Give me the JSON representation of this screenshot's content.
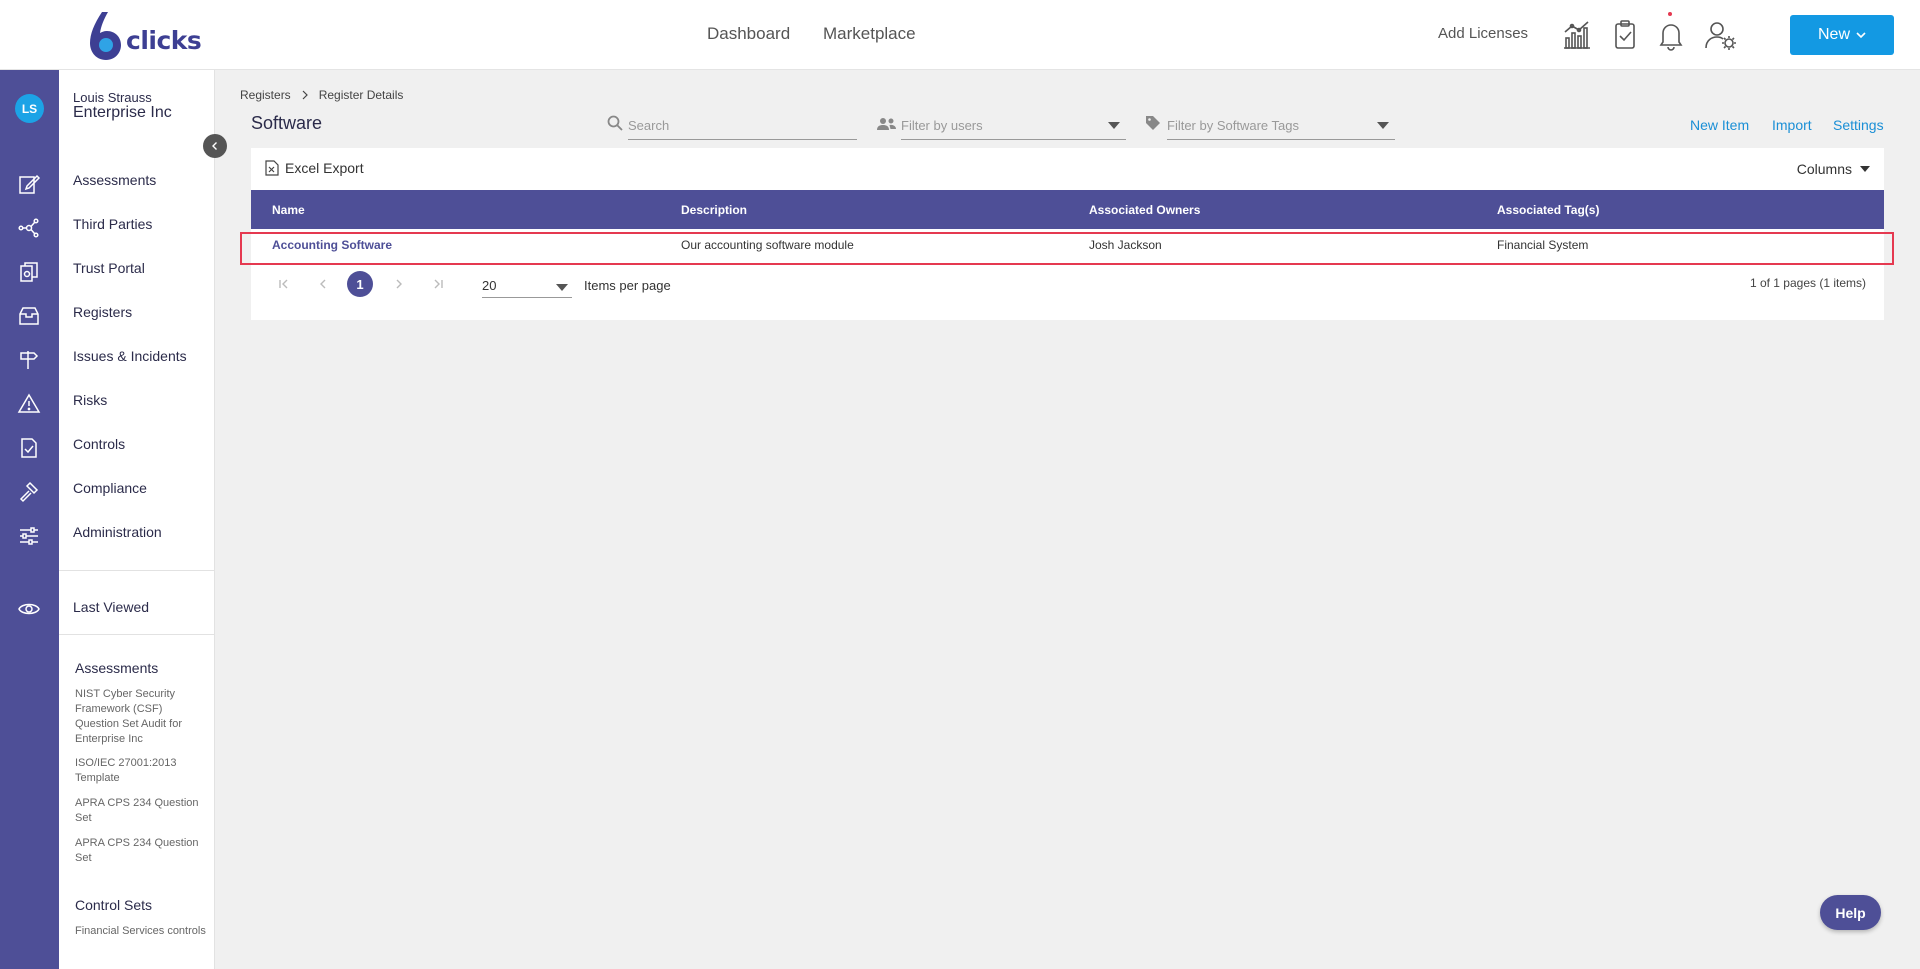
{
  "header": {
    "logo_text": "clicks",
    "nav": [
      {
        "label": "Dashboard"
      },
      {
        "label": "Marketplace"
      }
    ],
    "add_licenses": "Add Licenses",
    "new_button": "New"
  },
  "user": {
    "initials": "LS",
    "name": "Louis Strauss",
    "org": "Enterprise Inc"
  },
  "sidebar": {
    "items": [
      {
        "label": "Assessments",
        "icon": "edit-icon"
      },
      {
        "label": "Third Parties",
        "icon": "network-icon"
      },
      {
        "label": "Trust Portal",
        "icon": "documents-icon"
      },
      {
        "label": "Registers",
        "icon": "inbox-icon"
      },
      {
        "label": "Issues & Incidents",
        "icon": "signpost-icon"
      },
      {
        "label": "Risks",
        "icon": "warning-icon"
      },
      {
        "label": "Controls",
        "icon": "checklist-icon"
      },
      {
        "label": "Compliance",
        "icon": "gavel-icon"
      },
      {
        "label": "Administration",
        "icon": "sliders-icon"
      }
    ],
    "last_viewed": "Last Viewed",
    "recent_sections": [
      {
        "title": "Assessments",
        "items": [
          "NIST Cyber Security Framework (CSF) Question Set Audit for Enterprise Inc",
          "ISO/IEC 27001:2013 Template",
          "APRA CPS 234 Question Set",
          "APRA CPS 234 Question Set"
        ]
      },
      {
        "title": "Control Sets",
        "items": [
          "Financial Services controls"
        ]
      }
    ]
  },
  "breadcrumb": [
    "Registers",
    "Register Details"
  ],
  "page_title": "Software",
  "filters": {
    "search_placeholder": "Search",
    "users_placeholder": "Filter by users",
    "tags_placeholder": "Filter by Software Tags"
  },
  "actions": {
    "new_item": "New Item",
    "import": "Import",
    "settings": "Settings"
  },
  "grid": {
    "excel_export": "Excel Export",
    "columns_button": "Columns",
    "headers": [
      "Name",
      "Description",
      "Associated Owners",
      "Associated Tag(s)"
    ],
    "rows": [
      [
        "Accounting Software",
        "Our accounting software module",
        "Josh Jackson",
        "Financial System"
      ]
    ]
  },
  "pager": {
    "current_page": "1",
    "page_size": "20",
    "items_per_page": "Items per page",
    "info": "1 of 1 pages (1 items)"
  },
  "help_label": "Help",
  "colors": {
    "brand": "#4e4f97",
    "accent": "#1399e3",
    "highlight": "#e53950"
  }
}
